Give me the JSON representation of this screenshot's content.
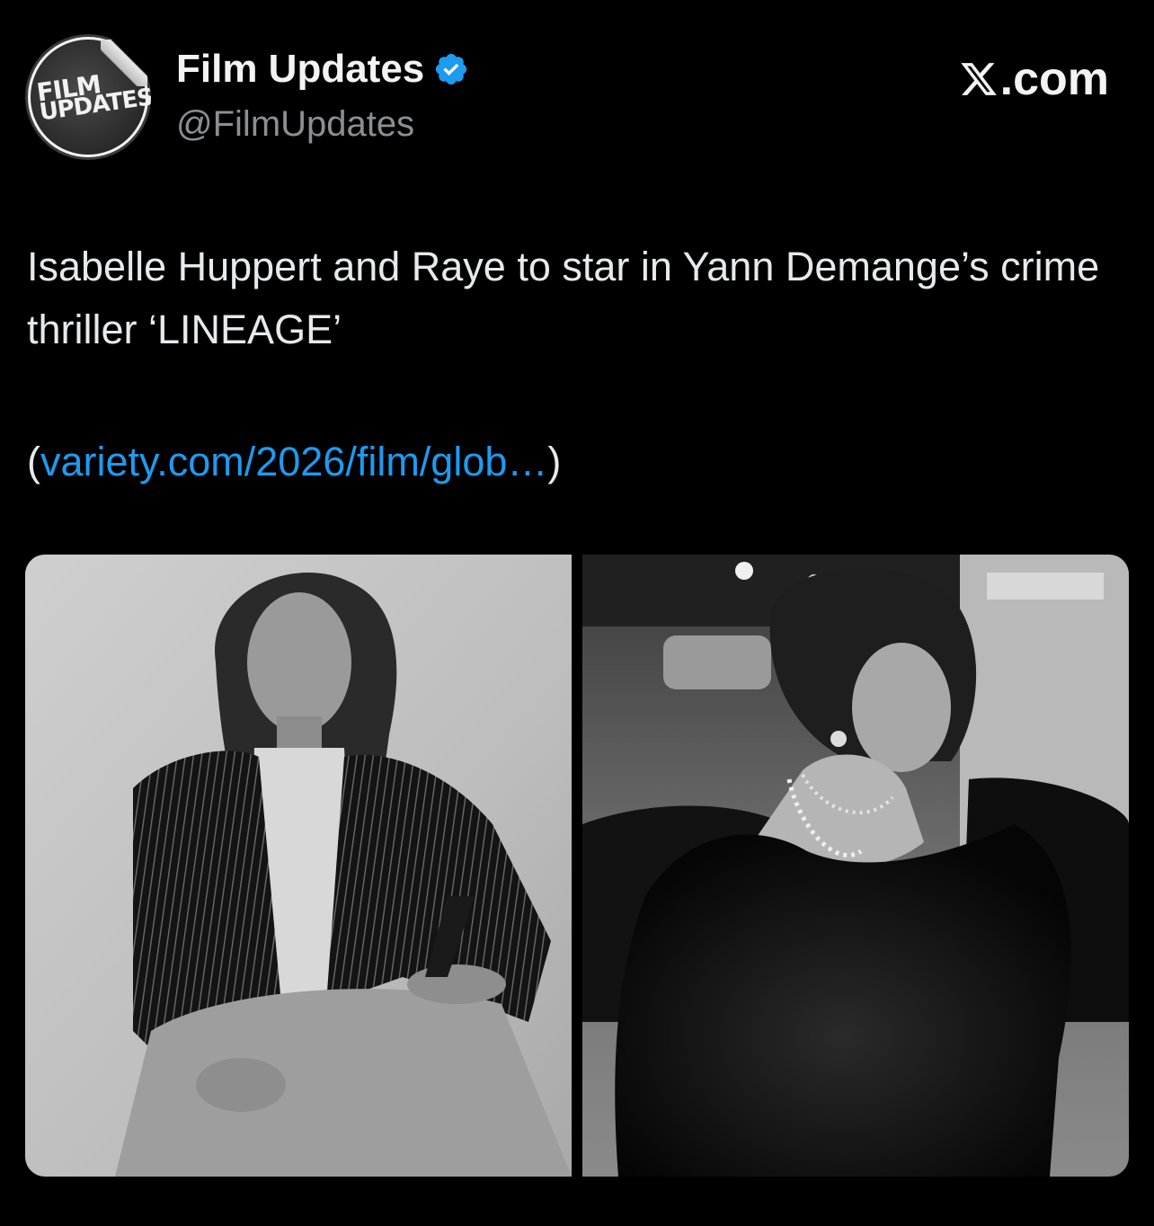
{
  "header": {
    "avatar": {
      "line1": "FILM",
      "line2": "UPDATES",
      "icon": "film-updates-logo"
    },
    "display_name": "Film Updates",
    "verified_icon": "verified-badge-icon",
    "handle": "@FilmUpdates",
    "brand": ".com",
    "brand_icon": "x-logo-icon"
  },
  "post": {
    "text": "Isabelle Huppert and Raye to star in Yann Demange’s crime thriller ‘LINEAGE’",
    "link_open": "(",
    "link_text": "variety.com/2026/film/glob…",
    "link_close": ")"
  },
  "media": [
    {
      "icon": "photo-isabelle-huppert",
      "alt": "Black and white portrait of a woman in a pinstripe blazer seated in a chair"
    },
    {
      "icon": "photo-raye",
      "alt": "Black and white portrait of a woman in a fur coat and pearl necklaces looking over her shoulder"
    }
  ],
  "colors": {
    "background": "#000000",
    "text": "#e7e9ea",
    "secondary": "#8b8f94",
    "link": "#1d9bf0",
    "verified": "#1d9bf0"
  }
}
